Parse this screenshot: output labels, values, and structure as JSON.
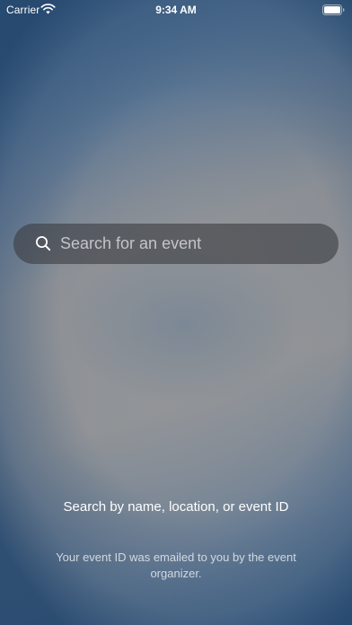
{
  "status_bar": {
    "carrier": "Carrier",
    "time": "9:34 AM",
    "icons": [
      "wifi-icon",
      "battery-icon"
    ]
  },
  "search": {
    "placeholder": "Search for an event",
    "value": "",
    "icon": "search-icon"
  },
  "hint": {
    "title": "Search by name, location, or event ID",
    "subtitle": "Your event ID was emailed to you by the event organizer."
  },
  "colors": {
    "background_blue": "#2f5884",
    "background_gray": "#8c9096",
    "search_bar_bg": "#3c3e42",
    "text": "#ffffff"
  }
}
